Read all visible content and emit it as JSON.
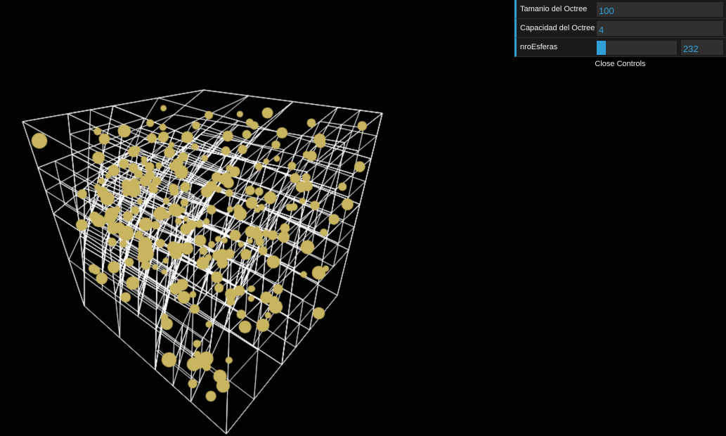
{
  "controls": {
    "rows": [
      {
        "label": "Tamanio del Octree",
        "value": "100"
      },
      {
        "label": "Capacidad del Octree",
        "value": "4"
      },
      {
        "label": "nroEsferas",
        "value": "232",
        "slider_fraction": 0.116
      }
    ],
    "close_label": "Close Controls",
    "accent_color": "#2fa1d6"
  },
  "scene": {
    "background_color": "#000000",
    "wireframe_color": "#ffffff",
    "sphere_color": "#c8b560",
    "sphere_count": 232
  }
}
